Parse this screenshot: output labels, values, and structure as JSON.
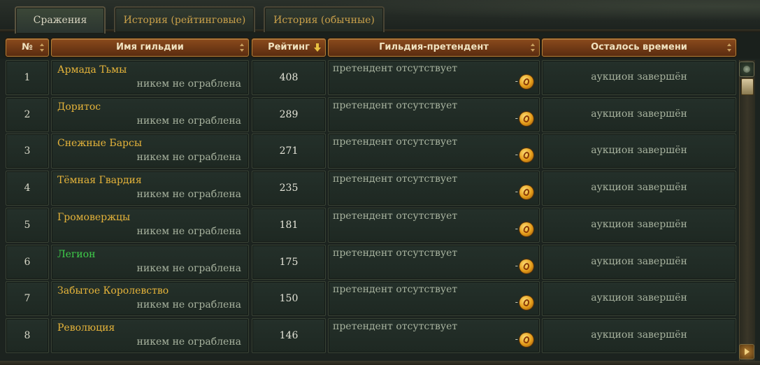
{
  "tabs": [
    {
      "label": "Сражения",
      "active": true
    },
    {
      "label": "История (рейтинговые)",
      "active": false
    },
    {
      "label": "История (обычные)",
      "active": false
    }
  ],
  "columns": {
    "num": "№",
    "guild": "Имя гильдии",
    "rating": "Рейтинг",
    "challenger": "Гильдия-претендент",
    "time_left": "Осталось времени"
  },
  "rows": [
    {
      "num": "1",
      "guild": "Армада Тьмы",
      "robbed": "никем не ограблена",
      "rating": "408",
      "challenger": "претендент отсутствует",
      "dash": "-",
      "time_left": "аукцион завершён",
      "green": false
    },
    {
      "num": "2",
      "guild": "Доритос",
      "robbed": "никем не ограблена",
      "rating": "289",
      "challenger": "претендент отсутствует",
      "dash": "-",
      "time_left": "аукцион завершён",
      "green": false
    },
    {
      "num": "3",
      "guild": "Снежные Барсы",
      "robbed": "никем не ограблена",
      "rating": "271",
      "challenger": "претендент отсутствует",
      "dash": "-",
      "time_left": "аукцион завершён",
      "green": false
    },
    {
      "num": "4",
      "guild": "Тёмная Гвардия",
      "robbed": "никем не ограблена",
      "rating": "235",
      "challenger": "претендент отсутствует",
      "dash": "-",
      "time_left": "аукцион завершён",
      "green": false
    },
    {
      "num": "5",
      "guild": "Громовержцы",
      "robbed": "никем не ограблена",
      "rating": "181",
      "challenger": "претендент отсутствует",
      "dash": "-",
      "time_left": "аукцион завершён",
      "green": false
    },
    {
      "num": "6",
      "guild": "Легион",
      "robbed": "никем не ограблена",
      "rating": "175",
      "challenger": "претендент отсутствует",
      "dash": "-",
      "time_left": "аукцион завершён",
      "green": true
    },
    {
      "num": "7",
      "guild": "Забытое Королевство",
      "robbed": "никем не ограблена",
      "rating": "150",
      "challenger": "претендент отсутствует",
      "dash": "-",
      "time_left": "аукцион завершён",
      "green": false
    },
    {
      "num": "8",
      "guild": "Революция",
      "robbed": "никем не ограблена",
      "rating": "146",
      "challenger": "претендент отсутствует",
      "dash": "-",
      "time_left": "аукцион завершён",
      "green": false
    }
  ],
  "colors": {
    "guild_name": "#e6b43a",
    "guild_name_highlight": "#3fcf4a",
    "header_bg": "#7a3e18",
    "muted_text": "#a7b29e"
  },
  "icons": {
    "coin": "gold-coin-icon",
    "sort": "sort-arrows-icon",
    "sort_active": "sort-desc-icon"
  }
}
